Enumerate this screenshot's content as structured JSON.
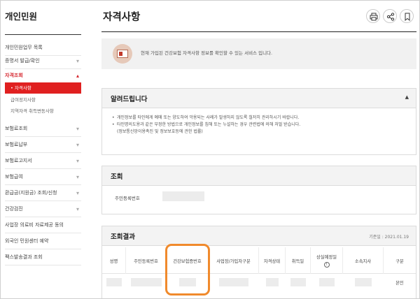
{
  "sidebar": {
    "title": "개인민원",
    "items": [
      {
        "label": "개인민원업무 목록",
        "chev": ""
      },
      {
        "label": "증명서 발급/확인",
        "chev": "▾"
      },
      {
        "label": "자격조회",
        "chev": "▴"
      },
      {
        "label": "보험료조회",
        "chev": "▾"
      },
      {
        "label": "보험료납부",
        "chev": "▾"
      },
      {
        "label": "보험료고지서",
        "chev": "▾"
      },
      {
        "label": "보험급여",
        "chev": "▾"
      },
      {
        "label": "환급금(지원금) 조회/신청",
        "chev": "▾"
      },
      {
        "label": "건강검진",
        "chev": "▾"
      },
      {
        "label": "사업장 의료비 자료제공 동의",
        "chev": ""
      },
      {
        "label": "외국인 민원센터 예약",
        "chev": ""
      },
      {
        "label": "팩스발송결과 조회",
        "chev": ""
      }
    ],
    "subitems": [
      {
        "label": "• 자격사항"
      },
      {
        "label": "급여정지사항"
      },
      {
        "label": "지역자격 취득변동사항"
      }
    ]
  },
  "main": {
    "title": "자격사항",
    "tools": [
      "print-icon",
      "share-icon",
      "bookmark-icon"
    ],
    "info_text": "현재 가입된 건강보험 자격사항 정보를 확인할 수 있는 서비스 입니다.",
    "notice": {
      "heading": "알려드립니다",
      "caret": "▲",
      "lines": [
        "개인정보를 타인에게 예매 또는 양도하여 악용되는 사례가 발생하지 않도록 철저히 관리하시기 바랍니다.",
        "타인명의도용과 같은 부정한 방법으로 개인정보를 침해 또는 누설하는 경우 관련법에 의해 처벌 받습니다.",
        "(정보통신망이용촉진 및 정보보호등에 관한 법률)"
      ]
    },
    "query": {
      "heading": "조회",
      "label": "주민등록번호"
    },
    "results": {
      "heading": "조회결과",
      "date": "기준일 : 2021.01.19",
      "columns": [
        "성명",
        "주민등록번호",
        "건강보험증번호",
        "사업장/가입자구분",
        "자격상태",
        "취득일",
        "상실예정일",
        "소속지사",
        "구분"
      ],
      "last_cell": "본인"
    }
  },
  "colors": {
    "accent": "#e02020",
    "highlight": "#f08a2c"
  }
}
